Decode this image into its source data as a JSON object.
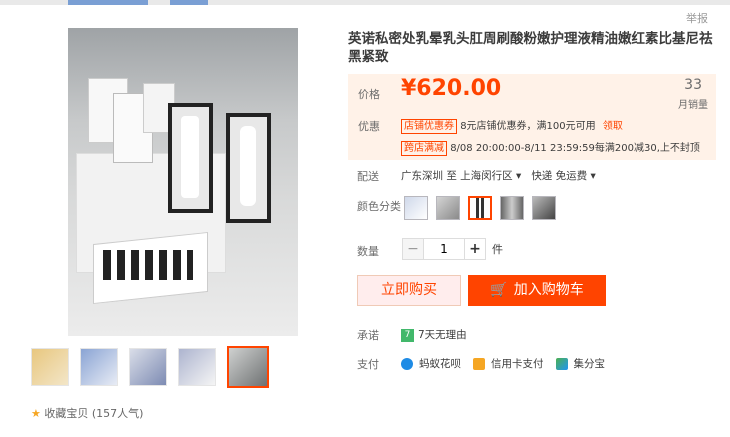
{
  "header": {
    "report_label": "举报"
  },
  "product": {
    "title": "英诺私密处乳晕乳头肛周刷酸粉嫩护理液精油嫩红素比基尼祛黑紧致",
    "price_label": "价格",
    "price": "¥620.00",
    "sales_count": "33",
    "sales_label": "月销量",
    "promo_label": "优惠",
    "promo1_tag": "店铺优惠券",
    "promo1_text": "8元店铺优惠券，满100元可用",
    "promo1_link": "领取",
    "promo2_tag": "跨店满减",
    "promo2_text": "8/08 20:00:00-8/11 23:59:59每满200减30,上不封顶"
  },
  "shipping": {
    "label": "配送",
    "from_to": "广东深圳 至 上海闵行区 ▾",
    "method": "快递 免运费 ▾"
  },
  "variants": {
    "label": "颜色分类",
    "icons": [
      "variant-1-icon",
      "variant-2-icon",
      "variant-3-icon",
      "variant-4-icon",
      "variant-5-icon"
    ],
    "selected_index": 2
  },
  "quantity": {
    "label": "数量",
    "value": "1",
    "minus": "−",
    "plus": "+",
    "unit": "件"
  },
  "actions": {
    "buy_now": "立即购买",
    "add_cart": "加入购物车"
  },
  "promise": {
    "label": "承诺",
    "badge": "7",
    "text": "7天无理由"
  },
  "payment": {
    "label": "支付",
    "methods": [
      "蚂蚁花呗",
      "信用卡支付",
      "集分宝"
    ]
  },
  "favorite": {
    "star": "★",
    "text": "收藏宝贝 (157人气)"
  },
  "colors": {
    "accent": "#ff4400",
    "price_bg": "#fff2e8",
    "promise_green": "#42b86b"
  }
}
